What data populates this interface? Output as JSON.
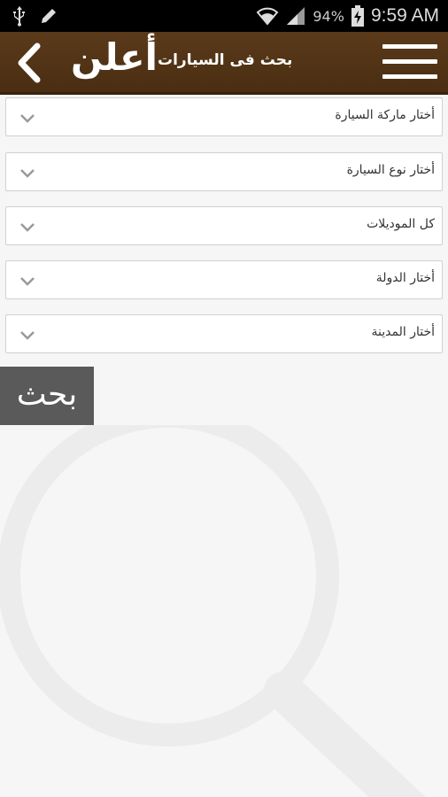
{
  "status_bar": {
    "battery": "94%",
    "time": "9:59 AM",
    "icons": [
      "usb-icon",
      "edit-icon",
      "wifi-icon",
      "signal-icon",
      "battery-charging-icon"
    ]
  },
  "header": {
    "logo": "أعلن",
    "title": "بحث فى السيارات",
    "menu_icon": "hamburger-icon",
    "back_icon": "chevron-left-icon"
  },
  "filters": [
    {
      "label": "أختار ماركة السيارة"
    },
    {
      "label": "أختار نوع السيارة"
    },
    {
      "label": "كل الموديلات"
    },
    {
      "label": "أختار الدولة"
    },
    {
      "label": "أختار المدينة"
    }
  ],
  "search_button": {
    "label": "بحث"
  },
  "colors": {
    "header": "#4e3115",
    "button": "#5a5a5a",
    "background": "#f6f6f6"
  }
}
